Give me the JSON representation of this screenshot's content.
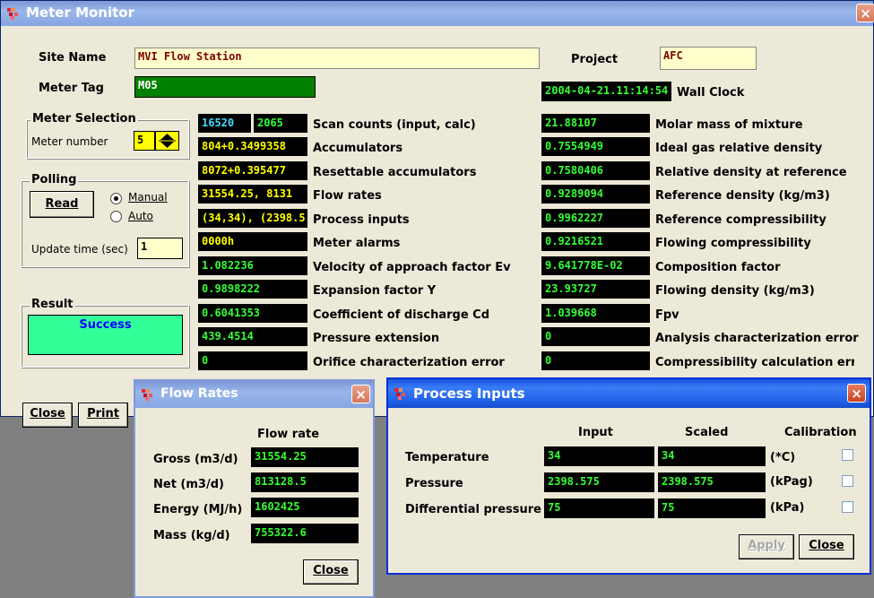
{
  "main_window": {
    "title": "Meter Monitor",
    "site_name_label": "Site Name",
    "site_name_value": "MVI Flow Station",
    "project_label": "Project",
    "project_value": "AFC",
    "meter_tag_label": "Meter Tag",
    "meter_tag_value": "M05",
    "wall_clock_value": "2004-04-21.11:14:54",
    "wall_clock_label": "Wall Clock",
    "meter_selection": {
      "title": "Meter Selection",
      "meter_number_label": "Meter number",
      "meter_number_value": "5"
    },
    "polling": {
      "title": "Polling",
      "read_button": "Read",
      "manual_label": "Manual",
      "auto_label": "Auto",
      "selected_mode": "Manual",
      "update_time_label": "Update time (sec)",
      "update_time_value": "1"
    },
    "result": {
      "title": "Result",
      "value": "Success"
    },
    "left_rows": [
      {
        "label": "Scan counts (input, calc)",
        "value": "16520",
        "value2": "2065"
      },
      {
        "label": "Accumulators",
        "value": "804+0.3499358"
      },
      {
        "label": "Resettable accumulators",
        "value": "8072+0.395477"
      },
      {
        "label": "Flow rates",
        "value": "31554.25, 8131"
      },
      {
        "label": "Process inputs",
        "value": "(34,34), (2398.5"
      },
      {
        "label": "Meter alarms",
        "value": "0000h"
      },
      {
        "label": "Velocity of approach factor Ev",
        "value": "1.082236"
      },
      {
        "label": "Expansion factor Y",
        "value": "0.9898222"
      },
      {
        "label": "Coefficient of discharge Cd",
        "value": "0.6041353"
      },
      {
        "label": "Pressure extension",
        "value": "439.4514"
      },
      {
        "label": "Orifice characterization error",
        "value": "0"
      }
    ],
    "right_rows": [
      {
        "label": "Molar mass of mixture",
        "value": "21.88107"
      },
      {
        "label": "Ideal gas relative density",
        "value": "0.7554949"
      },
      {
        "label": "Relative density at reference",
        "value": "0.7580406"
      },
      {
        "label": "Reference density (kg/m3)",
        "value": "0.9289094"
      },
      {
        "label": "Reference compressibility",
        "value": "0.9962227"
      },
      {
        "label": "Flowing compressibility",
        "value": "0.9216521"
      },
      {
        "label": "Composition factor",
        "value": "9.641778E-02"
      },
      {
        "label": "Flowing density (kg/m3)",
        "value": "23.93727"
      },
      {
        "label": "Fpv",
        "value": "1.039668"
      },
      {
        "label": "Analysis characterization error",
        "value": "0"
      },
      {
        "label": "Compressibility calculation err",
        "value": "0"
      }
    ],
    "close_button": "Close",
    "print_button": "Print"
  },
  "flow_rates_window": {
    "title": "Flow Rates",
    "column_header": "Flow rate",
    "rows": [
      {
        "label": "Gross (m3/d)",
        "value": "31554.25"
      },
      {
        "label": "Net (m3/d)",
        "value": "813128.5"
      },
      {
        "label": "Energy (MJ/h)",
        "value": "1602425"
      },
      {
        "label": "Mass (kg/d)",
        "value": "755322.6"
      }
    ],
    "close_button": "Close"
  },
  "process_inputs_window": {
    "title": "Process Inputs",
    "headers": {
      "input": "Input",
      "scaled": "Scaled",
      "calibration": "Calibration"
    },
    "rows": [
      {
        "label": "Temperature",
        "input": "34",
        "scaled": "34",
        "unit": "(*C)"
      },
      {
        "label": "Pressure",
        "input": "2398.575",
        "scaled": "2398.575",
        "unit": "(kPag)"
      },
      {
        "label": "Differential pressure",
        "input": "75",
        "scaled": "75",
        "unit": "(kPa)"
      }
    ],
    "apply_button": "Apply",
    "close_button": "Close"
  },
  "colors": {
    "field_black": "#000000",
    "value_yellow": "#ffff00",
    "value_green": "#34ff34",
    "value_cyan": "#44d8ff",
    "tag_green": "#008000",
    "result_bg": "#33ff99",
    "site_bg": "#ffffcc"
  },
  "icons": [
    "app-icon",
    "close-icon",
    "spin-up-down-icon",
    "checkbox-icon",
    "radio-icon"
  ]
}
